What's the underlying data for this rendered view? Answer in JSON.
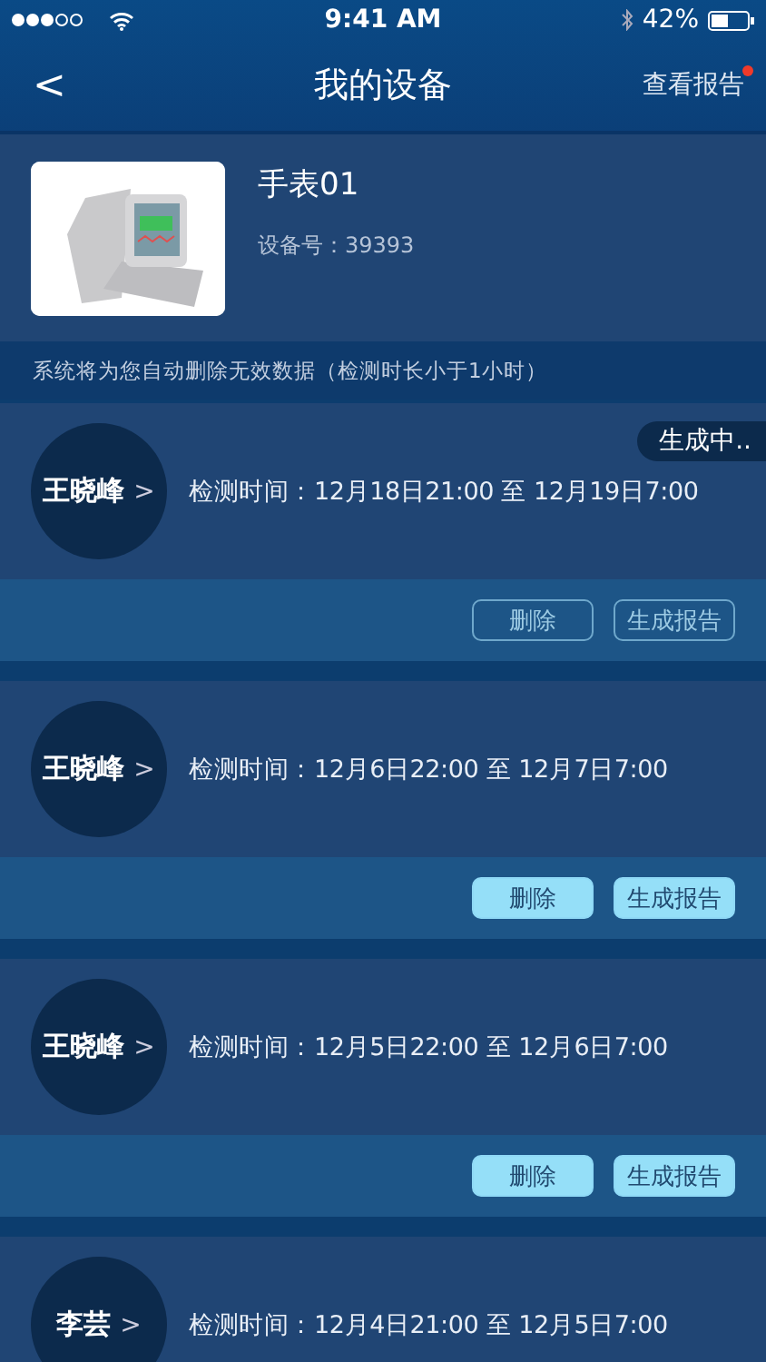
{
  "status_bar": {
    "time": "9:41 AM",
    "battery": "42%"
  },
  "nav": {
    "back": "<",
    "title": "我的设备",
    "action": "查看报告",
    "action_badge": true
  },
  "device": {
    "kind": "picture",
    "name": "手表01",
    "serial": "设备号：39393"
  },
  "notice": "系统将为您自动删除无效数据（检测时长小于1小时）",
  "records": [
    {
      "name": "王晓峰",
      "chevron": ">",
      "time": "检测时间：12月18日21:00 至 12月19日7:00",
      "status": "生成中..",
      "buttons": [
        {
          "label": "删除",
          "disabled": true
        },
        {
          "label": "生成报告",
          "disabled": true
        }
      ]
    },
    {
      "name": "王晓峰",
      "chevron": ">",
      "time": "检测时间：12月6日22:00 至 12月7日7:00",
      "buttons": [
        {
          "label": "删除",
          "disabled": false
        },
        {
          "label": "生成报告",
          "disabled": false
        }
      ]
    },
    {
      "name": "王晓峰",
      "chevron": ">",
      "time": "检测时间：12月5日22:00 至 12月6日7:00",
      "buttons": [
        {
          "label": "删除",
          "disabled": false
        },
        {
          "label": "生成报告",
          "disabled": false
        }
      ]
    },
    {
      "name": "李芸",
      "chevron": ">",
      "time": "检测时间：12月4日21:00 至 12月5日7:00"
    }
  ]
}
